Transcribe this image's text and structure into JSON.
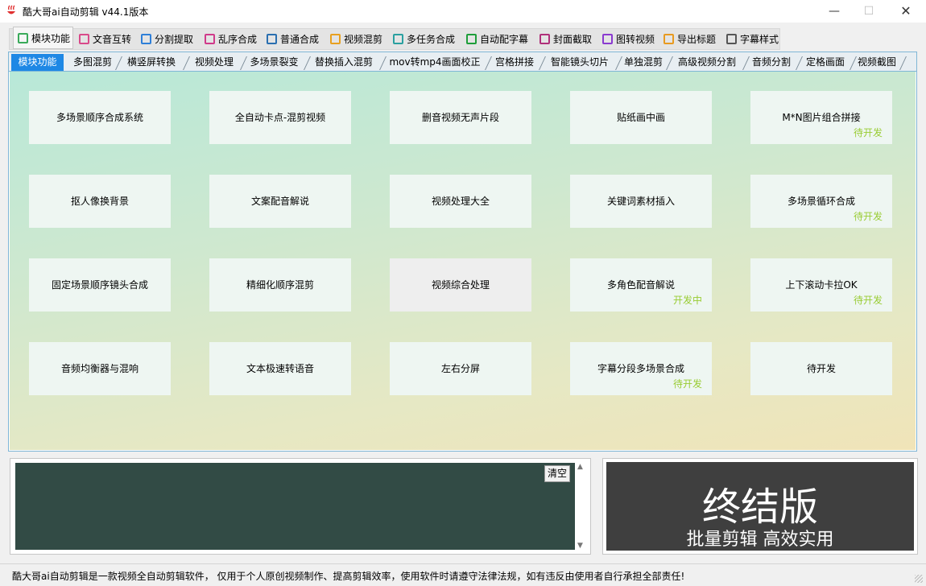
{
  "window": {
    "title": "酷大哥ai自动剪辑 v44.1版本",
    "minimize": "—",
    "maximize": "☐",
    "close": "✕"
  },
  "main_tabs": [
    {
      "label": "模块功能",
      "icon": "grid-icon",
      "color": "#3aaa5a"
    },
    {
      "label": "文音互转",
      "icon": "text-audio-icon",
      "color": "#d94a8a"
    },
    {
      "label": "分割提取",
      "icon": "split-icon",
      "color": "#2f7fd8"
    },
    {
      "label": "乱序合成",
      "icon": "shuffle-icon",
      "color": "#d03a8a"
    },
    {
      "label": "普通合成",
      "icon": "layers-icon",
      "color": "#2a6fb0"
    },
    {
      "label": "视频混剪",
      "icon": "video-mix-icon",
      "color": "#e8a020"
    },
    {
      "label": "多任务合成",
      "icon": "checklist-icon",
      "color": "#2aa0a0"
    },
    {
      "label": "自动配字幕",
      "icon": "chart-icon",
      "color": "#1e9e3a"
    },
    {
      "label": "封面截取",
      "icon": "image-crop-icon",
      "color": "#b0307a"
    },
    {
      "label": "图转视频",
      "icon": "image-video-icon",
      "color": "#8a3ad0"
    },
    {
      "label": "导出标题",
      "icon": "export-icon",
      "color": "#e89a20"
    },
    {
      "label": "字幕样式",
      "icon": "text-style-icon",
      "color": "#555555"
    }
  ],
  "sub_tabs": [
    "模块功能",
    "多图混剪",
    "横竖屏转换",
    "视频处理",
    "多场景裂变",
    "替换插入混剪",
    "mov转mp4画面校正",
    "宫格拼接",
    "智能镜头切片",
    "单独混剪",
    "高级视频分割",
    "音频分割",
    "定格画面",
    "视频截图"
  ],
  "functions": [
    {
      "label": "多场景顺序合成系统",
      "tag": ""
    },
    {
      "label": "全自动卡点-混剪视频",
      "tag": ""
    },
    {
      "label": "删音视频无声片段",
      "tag": ""
    },
    {
      "label": "贴纸画中画",
      "tag": ""
    },
    {
      "label": "M*N图片组合拼接",
      "tag": "待开发"
    },
    {
      "label": "抠人像换背景",
      "tag": ""
    },
    {
      "label": "文案配音解说",
      "tag": ""
    },
    {
      "label": "视频处理大全",
      "tag": ""
    },
    {
      "label": "关键词素材插入",
      "tag": ""
    },
    {
      "label": "多场景循环合成",
      "tag": "待开发"
    },
    {
      "label": "固定场景顺序镜头合成",
      "tag": ""
    },
    {
      "label": "精细化顺序混剪",
      "tag": ""
    },
    {
      "label": "视频综合处理",
      "tag": ""
    },
    {
      "label": "多角色配音解说",
      "tag": "开发中"
    },
    {
      "label": "上下滚动卡拉OK",
      "tag": "待开发"
    },
    {
      "label": "音频均衡器与混响",
      "tag": ""
    },
    {
      "label": "文本极速转语音",
      "tag": ""
    },
    {
      "label": "左右分屏",
      "tag": ""
    },
    {
      "label": "字幕分段多场景合成",
      "tag": "待开发"
    },
    {
      "label": "待开发",
      "tag": ""
    }
  ],
  "log": {
    "clear_label": "清空"
  },
  "promo": {
    "title": "终结版",
    "subtitle": "批量剪辑 高效实用"
  },
  "status": "酷大哥ai自动剪辑是一款视频全自动剪辑软件， 仅用于个人原创视频制作、提高剪辑效率，使用软件时请遵守法律法规，如有违反由使用者自行承担全部责任!"
}
